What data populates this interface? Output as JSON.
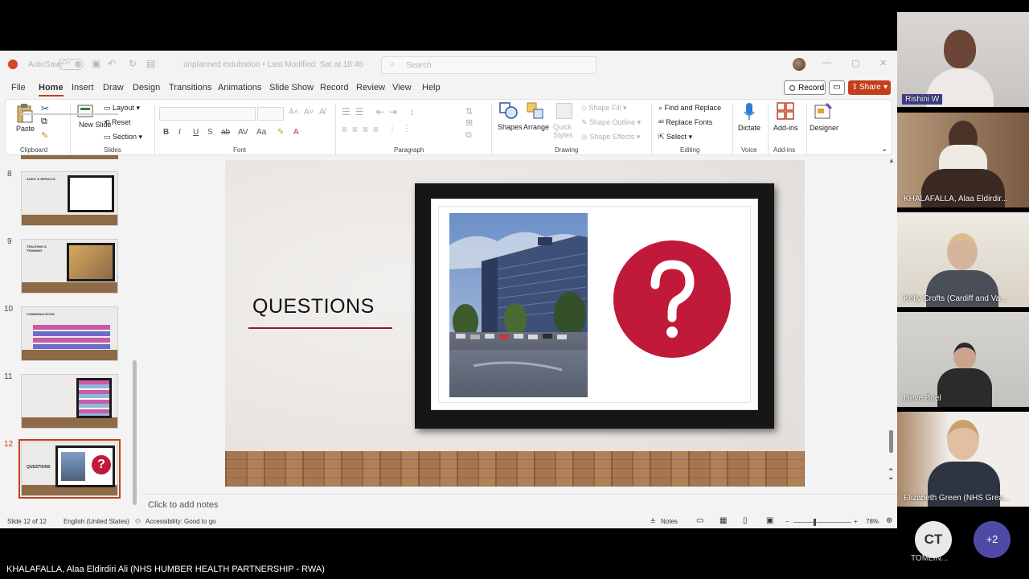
{
  "window": {
    "autosave_label": "AutoSave",
    "autosave_state": "On",
    "file_title": "unplanned extubation • Last Modified: Sat at 18:48",
    "search_placeholder": "Search"
  },
  "menu_tabs": [
    "File",
    "Home",
    "Insert",
    "Draw",
    "Design",
    "Transitions",
    "Animations",
    "Slide Show",
    "Record",
    "Review",
    "View",
    "Help"
  ],
  "active_tab": "Home",
  "actions": {
    "record": "Record",
    "share": "Share"
  },
  "ribbon": {
    "clipboard": {
      "label": "Clipboard",
      "paste": "Paste"
    },
    "slides": {
      "label": "Slides",
      "new_slide": "New Slide",
      "layout": "Layout",
      "reset": "Reset",
      "section": "Section"
    },
    "font": {
      "label": "Font"
    },
    "paragraph": {
      "label": "Paragraph"
    },
    "drawing": {
      "label": "Drawing",
      "shapes": "Shapes",
      "arrange": "Arrange",
      "quick_styles": "Quick Styles",
      "shape_fill": "Shape Fill",
      "shape_outline": "Shape Outline",
      "shape_effects": "Shape Effects"
    },
    "editing": {
      "label": "Editing",
      "find_replace": "Find and Replace",
      "replace_fonts": "Replace Fonts",
      "select": "Select"
    },
    "voice": {
      "label": "Voice",
      "dictate": "Dictate"
    },
    "addins": {
      "label": "Add-ins",
      "addins": "Add-ins"
    },
    "designer": "Designer"
  },
  "thumbnails": [
    {
      "num": "8",
      "title": "AUDIT & RESULTS"
    },
    {
      "num": "9",
      "title": "TEACHING & TRAINING"
    },
    {
      "num": "10",
      "title": "COMMUNICATION"
    },
    {
      "num": "11",
      "title": ""
    },
    {
      "num": "12",
      "title": "QUESTIONS"
    }
  ],
  "slide": {
    "title": "QUESTIONS",
    "accent": "#c0193a"
  },
  "notes_placeholder": "Click to add notes",
  "status": {
    "slide": "Slide 12 of 12",
    "language": "English (United States)",
    "accessibility": "Accessibility: Good to go",
    "notes": "Notes",
    "zoom": "78%"
  },
  "participants": [
    {
      "name": "Rishini W"
    },
    {
      "name": "KHALAFALLA, Alaa Eldirdir..."
    },
    {
      "name": "Kelly Crofts (Cardiff and Va..."
    },
    {
      "name": "Lieve Boel"
    },
    {
      "name": "Elizabeth Green (NHS Grea..."
    }
  ],
  "overflow": {
    "initials": "CT",
    "name": "TOMLIN...",
    "more": "+2"
  },
  "speaker": "KHALAFALLA, Alaa Eldirdiri Ali (NHS HUMBER HEALTH PARTNERSHIP - RWA)"
}
